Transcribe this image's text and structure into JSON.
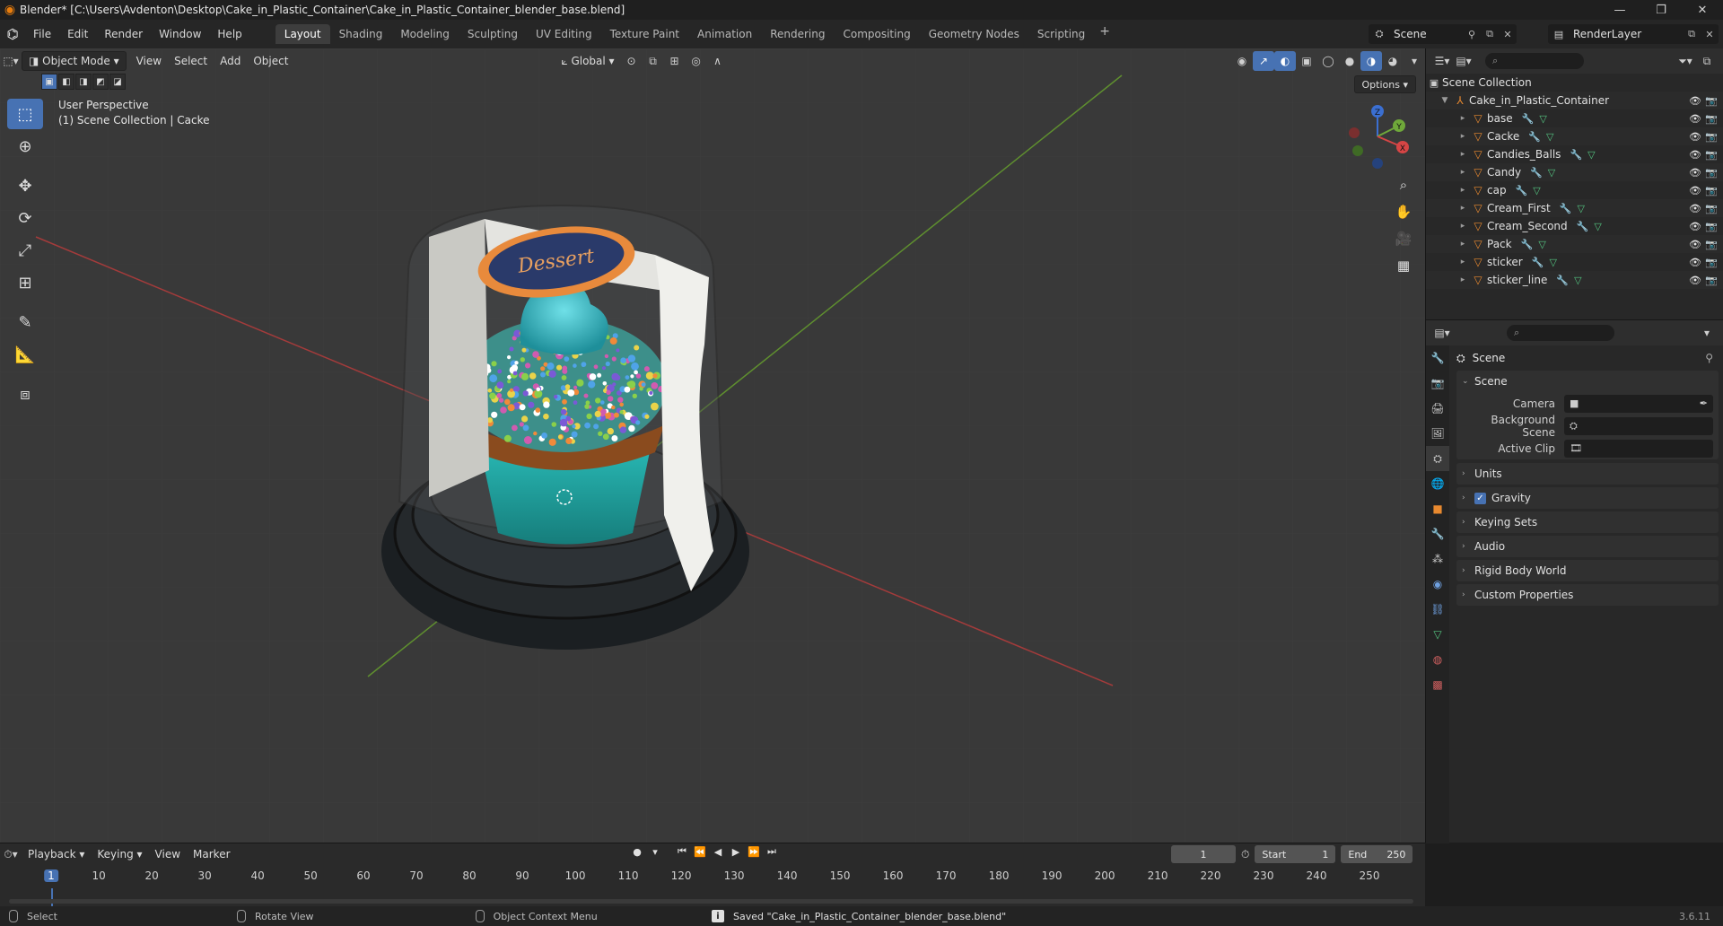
{
  "window": {
    "title": "Blender* [C:\\Users\\Avdenton\\Desktop\\Cake_in_Plastic_Container\\Cake_in_Plastic_Container_blender_base.blend]"
  },
  "menu": [
    "File",
    "Edit",
    "Render",
    "Window",
    "Help"
  ],
  "workspaces": [
    "Layout",
    "Shading",
    "Modeling",
    "Sculpting",
    "UV Editing",
    "Texture Paint",
    "Animation",
    "Rendering",
    "Compositing",
    "Geometry Nodes",
    "Scripting"
  ],
  "active_workspace": "Layout",
  "scene_selector": "Scene",
  "layer_selector": "RenderLayer",
  "viewport": {
    "mode": "Object Mode",
    "menus": [
      "View",
      "Select",
      "Add",
      "Object"
    ],
    "transform_orientation": "Global",
    "options_label": "Options",
    "info_line1": "User Perspective",
    "info_line2": "(1) Scene Collection | Cacke",
    "sticker_text": "Dessert"
  },
  "outliner": {
    "root": "Scene Collection",
    "collection": "Cake_in_Plastic_Container",
    "objects": [
      "base",
      "Cacke",
      "Candies_Balls",
      "Candy",
      "cap",
      "Cream_First",
      "Cream_Second",
      "Pack",
      "sticker",
      "sticker_line"
    ]
  },
  "properties": {
    "breadcrumb": "Scene",
    "panel_scene": "Scene",
    "camera_label": "Camera",
    "background_scene_label": "Background Scene",
    "active_clip_label": "Active Clip",
    "panels": [
      "Units",
      "Gravity",
      "Keying Sets",
      "Audio",
      "Rigid Body World",
      "Custom Properties"
    ]
  },
  "timeline": {
    "menus": [
      "Playback",
      "Keying",
      "View",
      "Marker"
    ],
    "current_frame": "1",
    "start_label": "Start",
    "start": "1",
    "end_label": "End",
    "end": "250",
    "ticks": [
      "1",
      "10",
      "20",
      "30",
      "40",
      "50",
      "60",
      "70",
      "80",
      "90",
      "100",
      "110",
      "120",
      "130",
      "140",
      "150",
      "160",
      "170",
      "180",
      "190",
      "200",
      "210",
      "220",
      "230",
      "240",
      "250"
    ]
  },
  "statusbar": {
    "select": "Select",
    "rotate": "Rotate View",
    "context": "Object Context Menu",
    "message": "Saved \"Cake_in_Plastic_Container_blender_base.blend\"",
    "version": "3.6.11"
  },
  "colors": {
    "accent": "#4772b3",
    "object_orange": "#e8892f",
    "cupcake_teal": "#1aa6a6"
  }
}
